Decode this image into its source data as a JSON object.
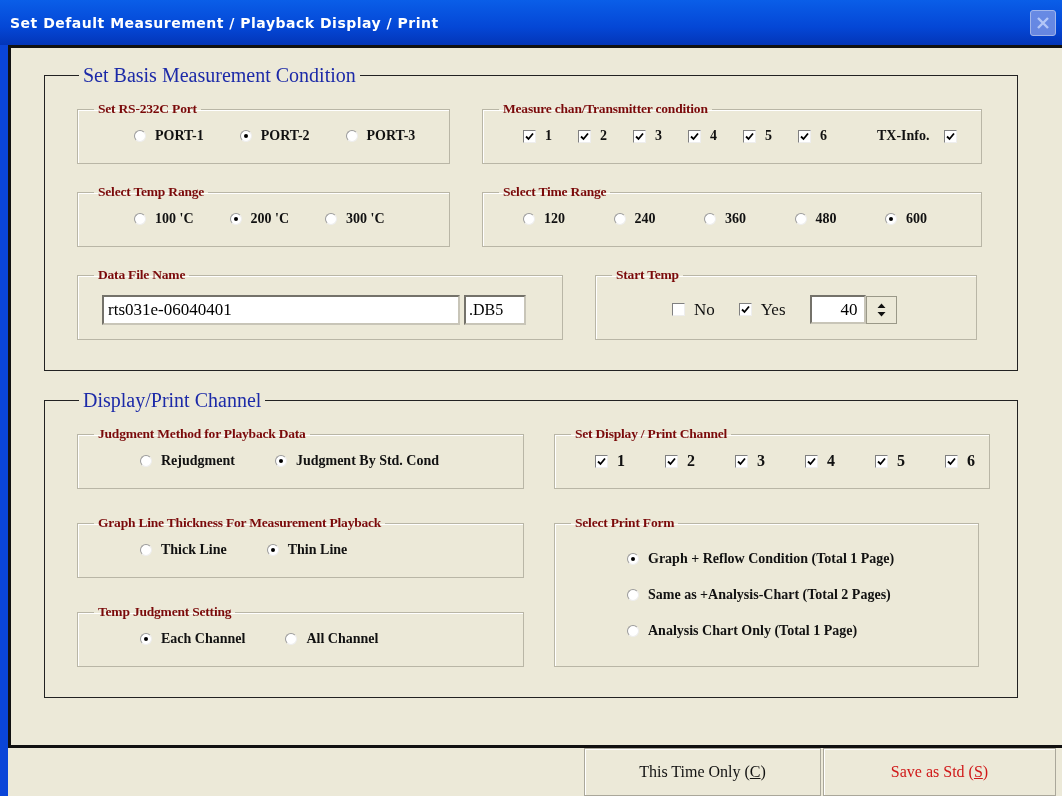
{
  "window": {
    "title": "Set Default Measurement / Playback Display / Print"
  },
  "sections": [
    {
      "title": "Set Basis Measurement Condition",
      "kind": "rows",
      "rows": [
        [
          {
            "title": "Set RS-232C Port",
            "kind": "radio",
            "options": [
              {
                "label": "PORT-1",
                "selected": false
              },
              {
                "label": "PORT-2",
                "selected": true
              },
              {
                "label": "PORT-3",
                "selected": false
              }
            ]
          },
          {
            "title": "Measure chan/Transmitter condition",
            "kind": "checks",
            "options": [
              {
                "kind": "channel",
                "label": "1",
                "checked": true
              },
              {
                "kind": "channel",
                "label": "2",
                "checked": true
              },
              {
                "kind": "channel",
                "label": "3",
                "checked": true
              },
              {
                "kind": "channel",
                "label": "4",
                "checked": true
              },
              {
                "kind": "channel",
                "label": "5",
                "checked": true
              },
              {
                "kind": "channel",
                "label": "6",
                "checked": true
              },
              {
                "kind": "tx",
                "label": "TX-Info.",
                "checked": true
              }
            ]
          }
        ],
        [
          {
            "title": "Select Temp Range",
            "kind": "radio",
            "options": [
              {
                "label": "100 'C",
                "selected": false
              },
              {
                "label": "200 'C",
                "selected": true
              },
              {
                "label": "300 'C",
                "selected": false
              }
            ]
          },
          {
            "title": "Select Time Range",
            "kind": "radio",
            "options": [
              {
                "label": "120",
                "selected": false
              },
              {
                "label": "240",
                "selected": false
              },
              {
                "label": "360",
                "selected": false
              },
              {
                "label": "480",
                "selected": false
              },
              {
                "label": "600",
                "selected": true
              }
            ]
          }
        ],
        [
          {
            "title": "Data File Name",
            "kind": "file",
            "value": "rts031e-06040401",
            "extension": ".DB5"
          },
          {
            "title": "Start Temp",
            "kind": "start_temp",
            "options": [
              {
                "label": "No",
                "checked": false
              },
              {
                "label": "Yes",
                "checked": true
              }
            ],
            "value": "40"
          }
        ]
      ]
    },
    {
      "title": "Display/Print Channel",
      "kind": "columns",
      "columns": [
        [
          {
            "title": "Judgment Method for Playback Data",
            "kind": "radio",
            "options": [
              {
                "label": "Rejudgment",
                "selected": false
              },
              {
                "label": "Judgment By Std. Cond",
                "selected": true
              }
            ]
          },
          {
            "title": "Graph Line Thickness For Measurement Playback",
            "kind": "radio",
            "options": [
              {
                "label": "Thick Line",
                "selected": false
              },
              {
                "label": "Thin Line",
                "selected": true
              }
            ]
          },
          {
            "title": "Temp Judgment Setting",
            "kind": "radio",
            "options": [
              {
                "label": "Each Channel",
                "selected": true
              },
              {
                "label": "All Channel",
                "selected": false
              }
            ]
          }
        ],
        [
          {
            "title": "Set Display / Print Channel",
            "kind": "checks",
            "options": [
              {
                "kind": "channel",
                "label": "1",
                "checked": true
              },
              {
                "kind": "channel",
                "label": "2",
                "checked": true
              },
              {
                "kind": "channel",
                "label": "3",
                "checked": true
              },
              {
                "kind": "channel",
                "label": "4",
                "checked": true
              },
              {
                "kind": "channel",
                "label": "5",
                "checked": true
              },
              {
                "kind": "channel",
                "label": "6",
                "checked": true
              }
            ]
          },
          {
            "title": "Select Print Form",
            "kind": "radio_list",
            "options": [
              {
                "label": "Graph + Reflow Condition (Total 1 Page)",
                "selected": true
              },
              {
                "label": "Same as +Analysis-Chart (Total 2 Pages)",
                "selected": false
              },
              {
                "label": "Analysis Chart Only (Total 1 Page)",
                "selected": false
              }
            ]
          }
        ]
      ]
    }
  ],
  "buttons": [
    {
      "kind": "normal",
      "before": "This Time Only (",
      "accelerator": "C",
      "after": ")"
    },
    {
      "kind": "save",
      "before": "Save as Std (",
      "accelerator": "S",
      "after": ")"
    }
  ]
}
